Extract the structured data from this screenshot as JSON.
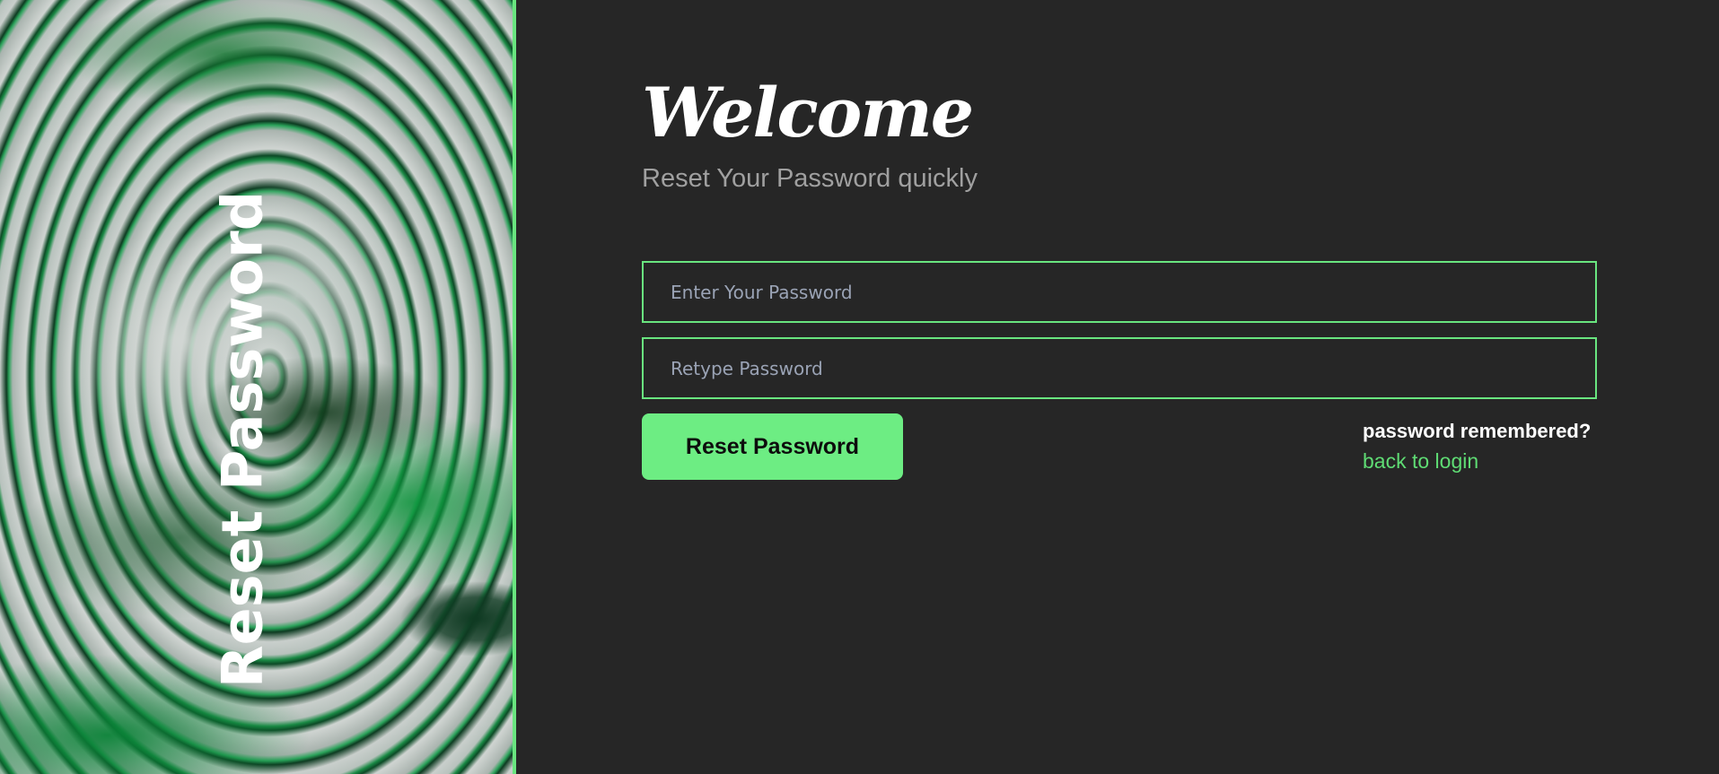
{
  "hero": {
    "title": "Reset Password",
    "image": "green-marble-artwork"
  },
  "main": {
    "heading": "Welcome",
    "subtitle": "Reset Your Password quickly"
  },
  "form": {
    "password": {
      "value": "",
      "placeholder": "Enter Your Password"
    },
    "retype_password": {
      "value": "",
      "placeholder": "Retype Password"
    },
    "submit_label": "Reset Password"
  },
  "footer_links": {
    "prompt": "password remembered?",
    "back_link_label": "back to login"
  },
  "colors": {
    "accent": "#6ded83",
    "background": "#262626",
    "link": "#5fdc74",
    "subtitle": "#a0a0a0"
  }
}
